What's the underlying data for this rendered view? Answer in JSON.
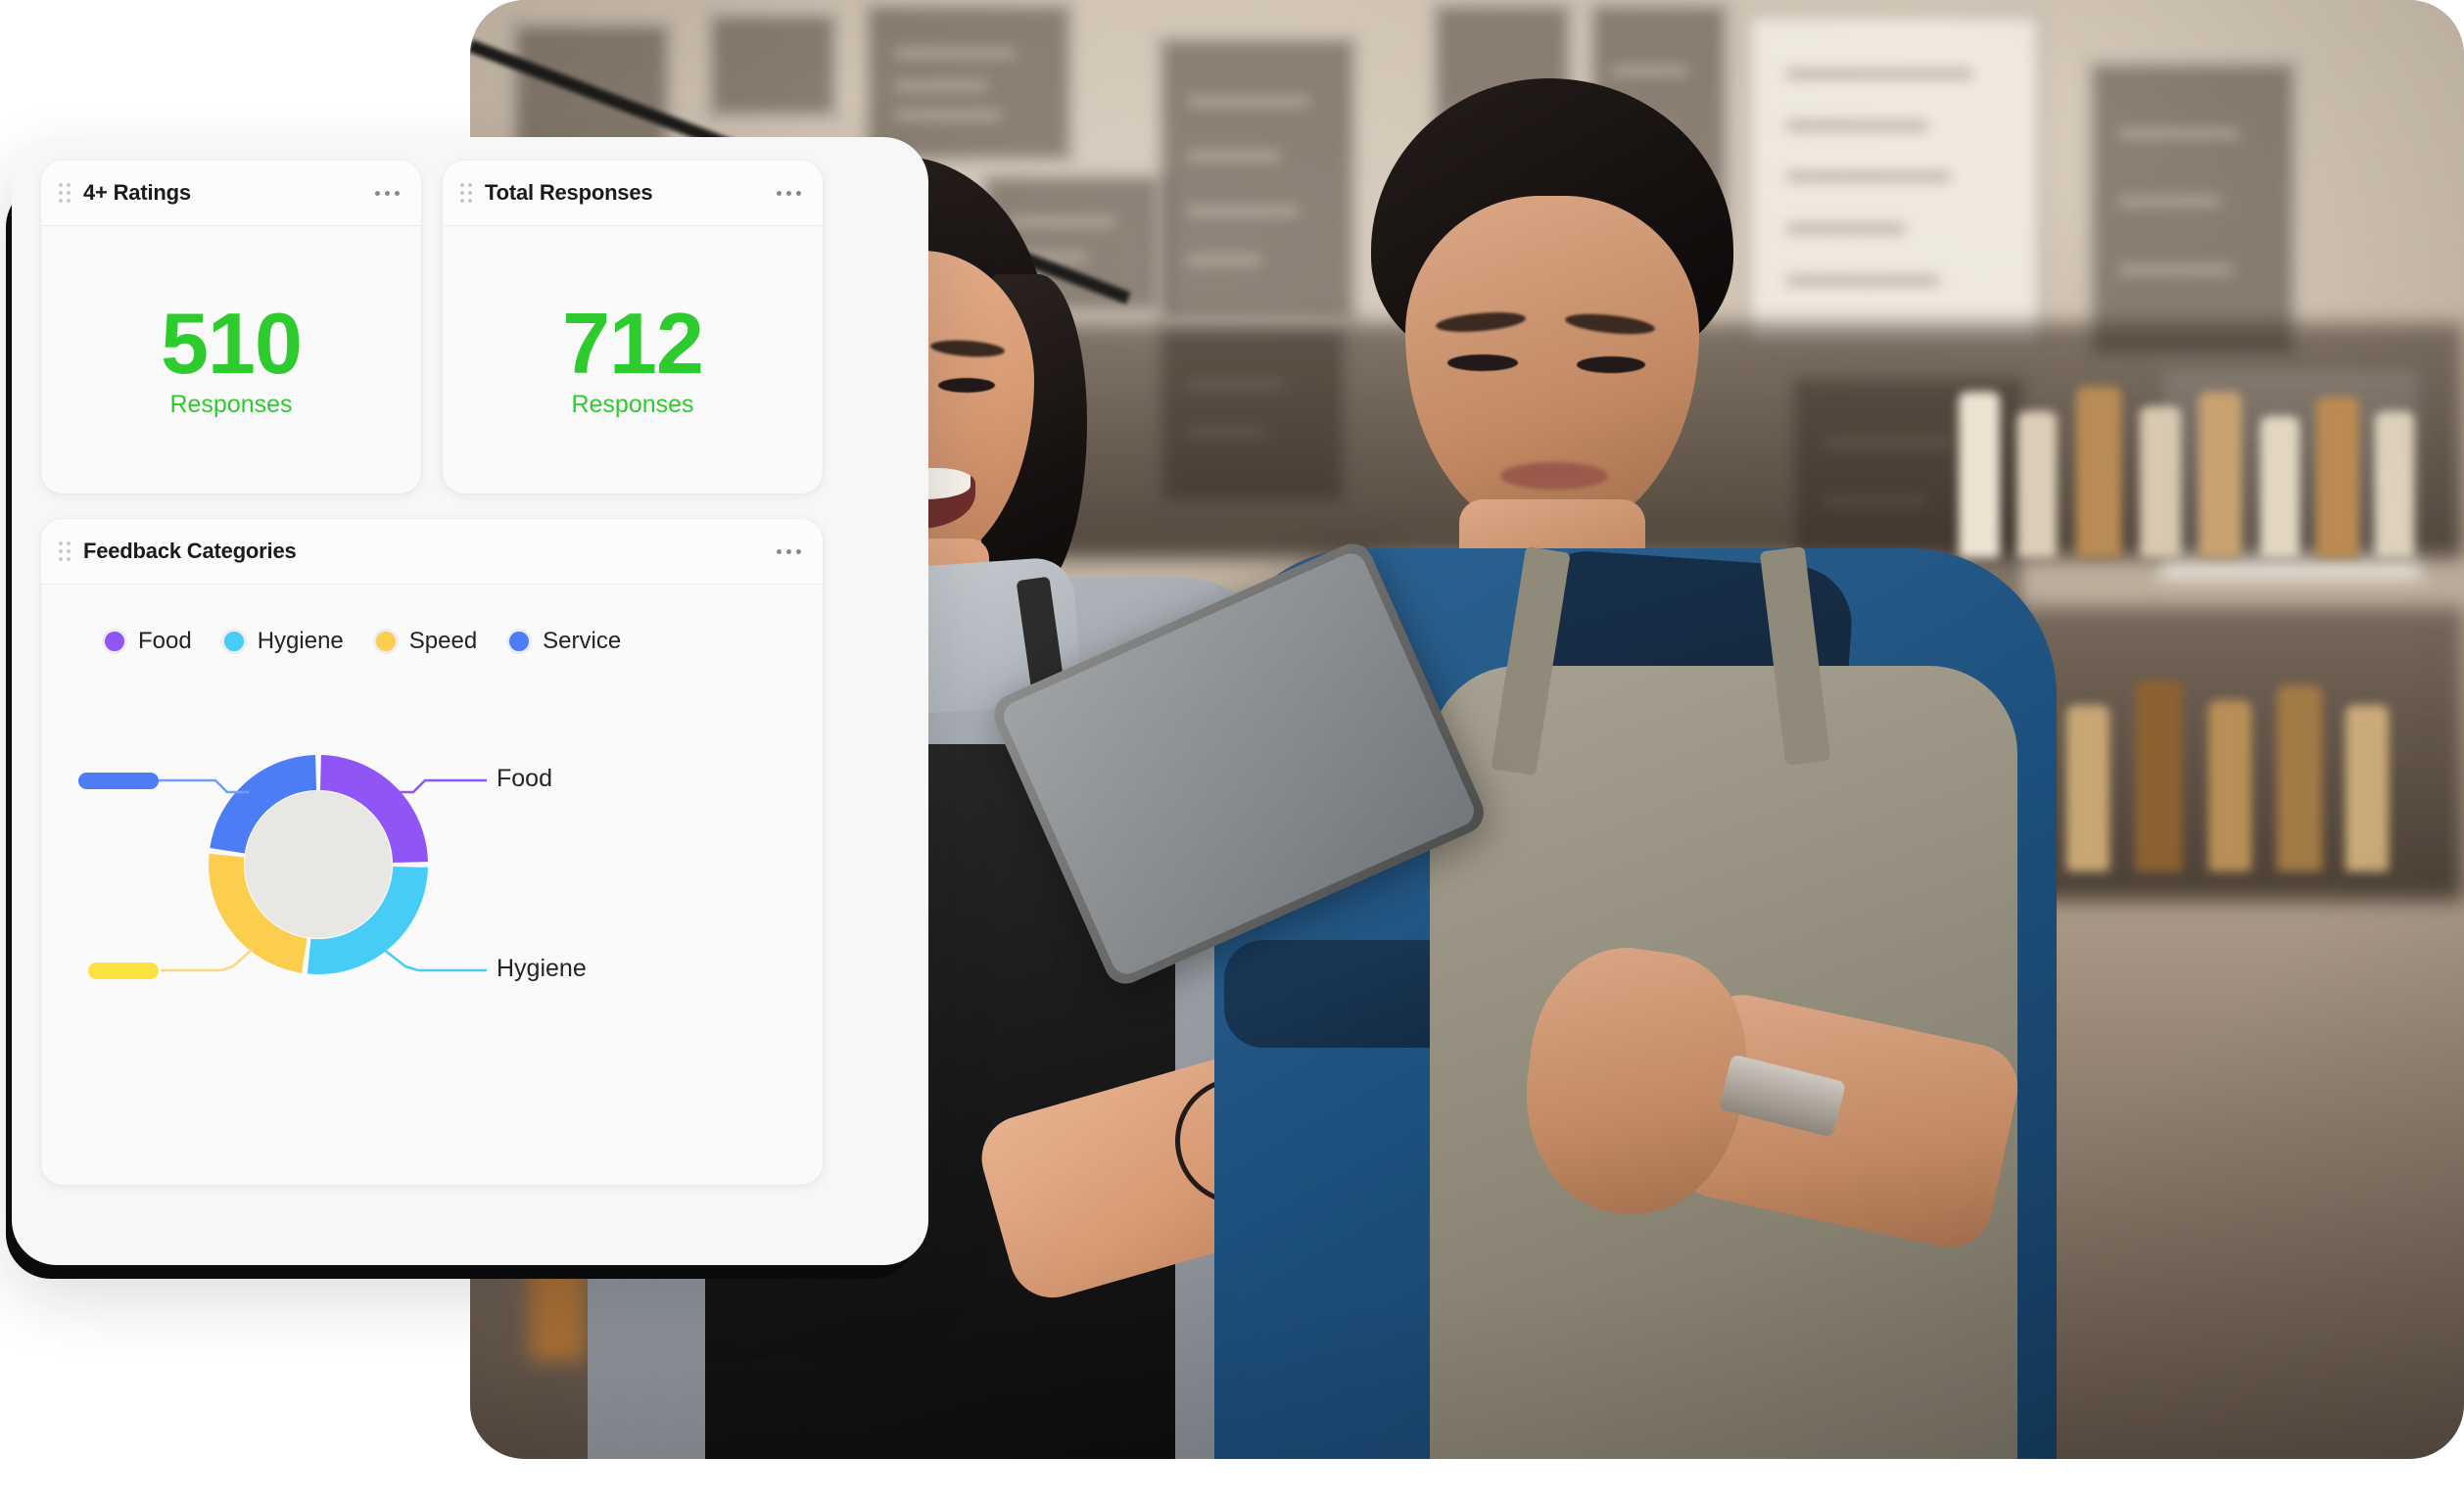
{
  "photo": {
    "alt": "Two cafe staff in aprons smiling while looking at a tablet",
    "scene": "cafe-interior"
  },
  "panel": {
    "cards": [
      {
        "id": "ratings",
        "title": "4+ Ratings",
        "drag_icon": "drag-handle-icon",
        "menu_icon": "kebab-menu-icon",
        "value": "510",
        "label": "Responses",
        "value_color": "#2ECB2E"
      },
      {
        "id": "total",
        "title": "Total Responses",
        "drag_icon": "drag-handle-icon",
        "menu_icon": "kebab-menu-icon",
        "value": "712",
        "label": "Responses",
        "value_color": "#2ECB2E"
      }
    ],
    "feedback": {
      "title": "Feedback Categories",
      "drag_icon": "drag-handle-icon",
      "menu_icon": "kebab-menu-icon",
      "legend": [
        {
          "label": "Food",
          "color": "#9055F5"
        },
        {
          "label": "Hygiene",
          "color": "#47CCF5"
        },
        {
          "label": "Speed",
          "color": "#FBCE4E"
        },
        {
          "label": "Service",
          "color": "#4C7DF5"
        }
      ],
      "callouts": [
        {
          "label": "Food",
          "color": "#9055F5",
          "side": "right"
        },
        {
          "label": "Hygiene",
          "color": "#47CCF5",
          "side": "right"
        },
        {
          "label": "",
          "color": "#4C7DF5",
          "side": "left",
          "redacted": true
        },
        {
          "label": "",
          "color": "#FBE23E",
          "side": "left",
          "redacted": true
        }
      ]
    }
  },
  "chart_data": {
    "type": "pie",
    "title": "Feedback Categories",
    "variant": "donut",
    "inner_radius_ratio": 0.68,
    "start_angle_deg": 0,
    "gap_deg": 3,
    "legend_position": "top",
    "categories": [
      "Food",
      "Hygiene",
      "Speed",
      "Service"
    ],
    "values": [
      25,
      27,
      25,
      23
    ],
    "unit": "%",
    "colors": [
      "#9055F5",
      "#47CCF5",
      "#FBCE4E",
      "#4C7DF5"
    ],
    "series": [
      {
        "name": "Feedback Categories",
        "values": [
          25,
          27,
          25,
          23
        ]
      }
    ],
    "annotations": [
      {
        "text": "Food",
        "points_to": "Food"
      },
      {
        "text": "Hygiene",
        "points_to": "Hygiene"
      }
    ]
  },
  "colors": {
    "accent_green": "#2ECB2E",
    "panel_bg": "#F7F7F8",
    "card_bg": "#FAFAFA",
    "backdrop": "#0B0B0C",
    "text_primary": "#1B1B1F",
    "donut_hole": "#E8E7E3"
  }
}
